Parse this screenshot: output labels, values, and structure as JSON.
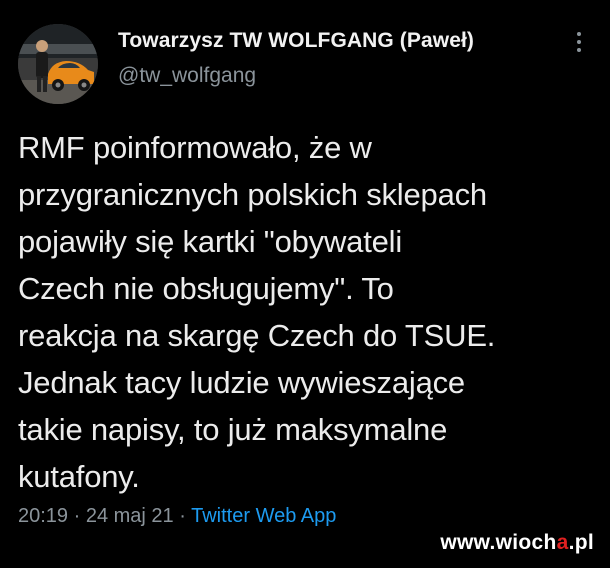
{
  "author": {
    "display_name": "Towarzysz TW WOLFGANG (Paweł)",
    "handle": "@tw_wolfgang",
    "avatar_icon": "user-avatar-with-orange-car"
  },
  "menu": {
    "icon": "more-vertical-icon"
  },
  "tweet": {
    "text": "RMF poinformowało, że w\nprzygranicznych polskich sklepach\npojawiły się kartki \"obywateli\nCzech nie obsługujemy\". To\nreakcja na skargę Czech do TSUE.\nJednak tacy ludzie wywieszające\ntakie napisy, to już maksymalne\nkutafony."
  },
  "meta": {
    "time": "20:19",
    "separator": " · ",
    "date": "24 maj 21",
    "source": "Twitter Web App"
  },
  "watermark": {
    "prefix": "www.wioch",
    "accent": "a",
    "suffix": ".pl"
  },
  "colors": {
    "background": "#000000",
    "text": "#e7e9ea",
    "secondary": "#8b949b",
    "link": "#1d9bf0"
  }
}
